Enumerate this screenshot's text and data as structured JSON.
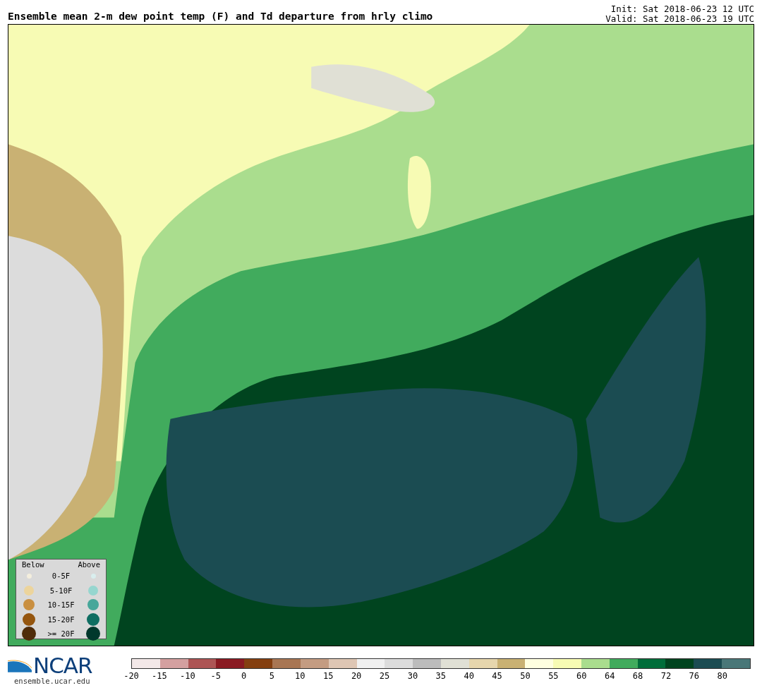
{
  "title": "Ensemble mean 2-m dew point temp (F) and Td departure from hrly climo",
  "run_info": [
    "Init: Sat 2018-06-23 12 UTC",
    "Valid: Sat 2018-06-23 19 UTC"
  ],
  "legend": {
    "headers": [
      "Below",
      "Above"
    ],
    "rows": [
      {
        "label": "0-5F",
        "below": {
          "color": "#f4eedd"
        },
        "above": {
          "color": "#d9eeee"
        }
      },
      {
        "label": "5-10F",
        "below": {
          "color": "#ecd49c"
        },
        "above": {
          "color": "#96d6cf"
        }
      },
      {
        "label": "10-15F",
        "below": {
          "color": "#c98f40"
        },
        "above": {
          "color": "#47a79a"
        }
      },
      {
        "label": "15-20F",
        "below": {
          "color": "#95560f"
        },
        "above": {
          "color": "#0f6e62"
        }
      },
      {
        "label": ">= 20F",
        "below": {
          "color": "#4f2c0a"
        },
        "above": {
          "color": "#00382c"
        }
      }
    ]
  },
  "logo": {
    "wordmark": "NCAR",
    "url": "ensemble.ucar.edu"
  },
  "colorbar": {
    "swatches": [
      {
        "color": "#f3e8e8"
      },
      {
        "color": "#d4a0a0"
      },
      {
        "color": "#ad5555"
      },
      {
        "color": "#8a1a22"
      },
      {
        "color": "#843f10"
      },
      {
        "color": "#a87653"
      },
      {
        "color": "#c49c82"
      },
      {
        "color": "#dec6b4"
      },
      {
        "color": "#f0f0f0"
      },
      {
        "color": "#dcdcdc"
      },
      {
        "color": "#bcbcbc"
      },
      {
        "color": "#e0e0d5"
      },
      {
        "color": "#e6d6ad"
      },
      {
        "color": "#c9b173"
      },
      {
        "color": "#ffffe0"
      },
      {
        "color": "#f7fbb4"
      },
      {
        "color": "#aadd8e"
      },
      {
        "color": "#41ab5d"
      },
      {
        "color": "#006d3a"
      },
      {
        "color": "#00441f"
      },
      {
        "color": "#1b4c52"
      },
      {
        "color": "#497778"
      }
    ],
    "ticks": [
      "-20",
      "-15",
      "-10",
      "-5",
      "0",
      "5",
      "10",
      "15",
      "20",
      "25",
      "30",
      "35",
      "40",
      "45",
      "50",
      "55",
      "60",
      "64",
      "68",
      "72",
      "76",
      "80"
    ]
  }
}
